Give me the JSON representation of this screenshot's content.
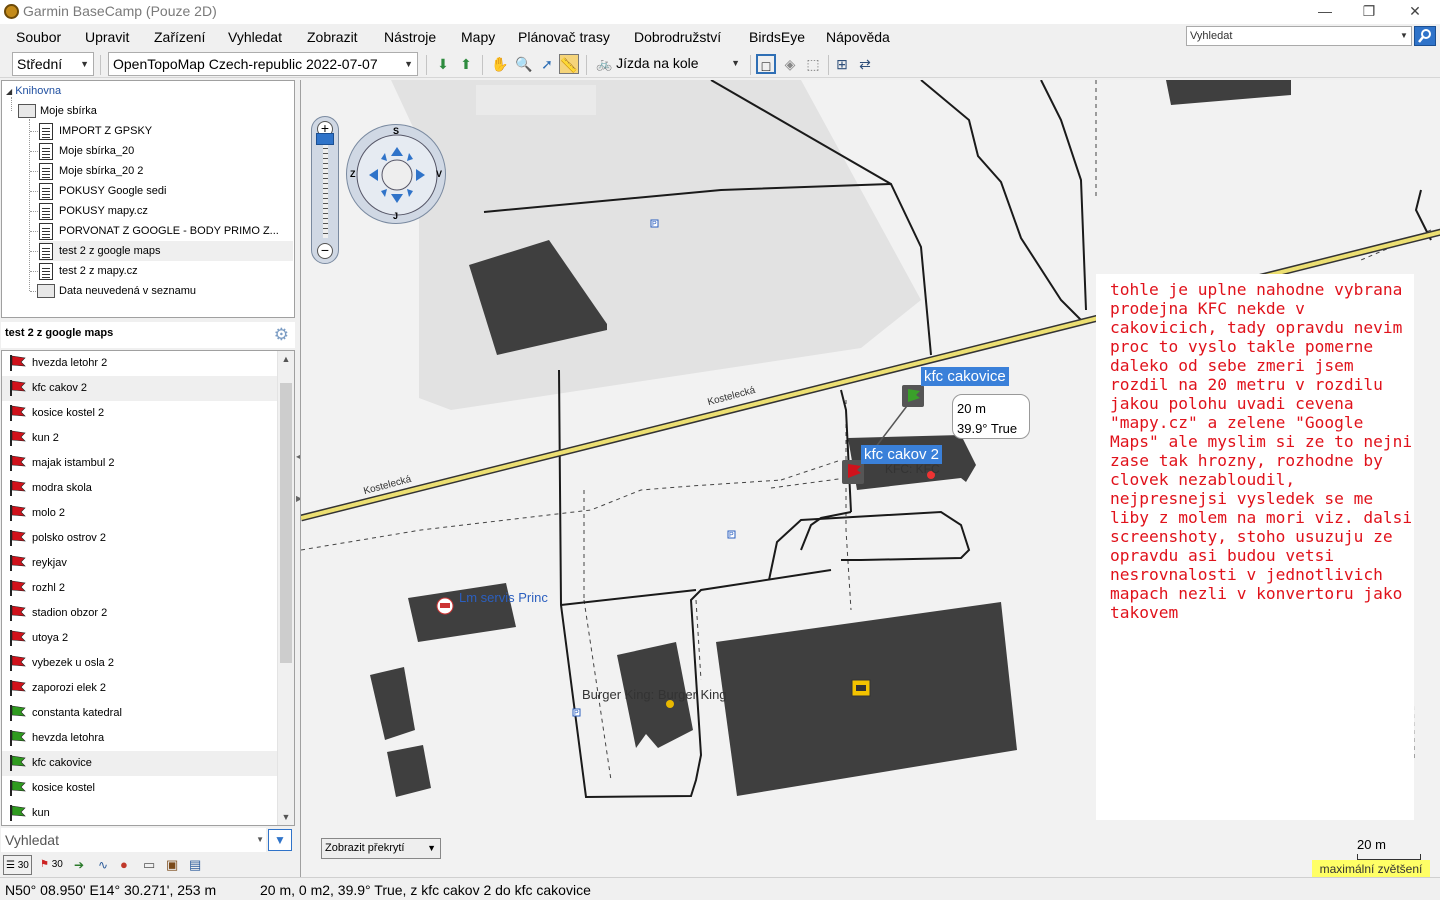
{
  "window": {
    "title": "Garmin BaseCamp (Pouze 2D)",
    "minimize": "—",
    "restore": "❐",
    "close": "✕"
  },
  "menu": [
    "Soubor",
    "Upravit",
    "Zařízení",
    "Vyhledat",
    "Zobrazit",
    "Nástroje",
    "Mapy",
    "Plánovač trasy",
    "Dobrodružství",
    "BirdsEye",
    "Nápověda"
  ],
  "top_search": {
    "placeholder": "Vyhledat"
  },
  "toolbar": {
    "detail_level": "Střední",
    "map_product": "OpenTopoMap Czech-republic 2022-07-07",
    "activity": "Jízda na kole"
  },
  "library": {
    "root": "Knihovna",
    "collection": "Moje sbírka",
    "items": [
      "IMPORT Z GPSKY",
      "Moje sbírka_20",
      "Moje sbírka_20 2",
      "POKUSY Google sedi",
      "POKUSY mapy.cz",
      "PORVONAT Z GOOGLE - BODY PRIMO Z...",
      "test 2 z google maps",
      "test 2 z mapy.cz"
    ],
    "unlisted": "Data neuvedená v seznamu",
    "selected_index": 6
  },
  "list": {
    "header": "test 2 z google maps",
    "items": [
      {
        "name": "hvezda letohr 2",
        "flag": "red"
      },
      {
        "name": "kfc cakov 2",
        "flag": "red",
        "selected": true
      },
      {
        "name": "kosice kostel 2",
        "flag": "red"
      },
      {
        "name": "kun 2",
        "flag": "red"
      },
      {
        "name": "majak istambul 2",
        "flag": "red"
      },
      {
        "name": "modra skola",
        "flag": "red"
      },
      {
        "name": "molo 2",
        "flag": "red"
      },
      {
        "name": "polsko ostrov 2",
        "flag": "red"
      },
      {
        "name": "reykjav",
        "flag": "red"
      },
      {
        "name": "rozhl 2",
        "flag": "red"
      },
      {
        "name": "stadion obzor 2",
        "flag": "red"
      },
      {
        "name": "utoya 2",
        "flag": "red"
      },
      {
        "name": "vybezek u osla 2",
        "flag": "red"
      },
      {
        "name": "zaporozi elek 2",
        "flag": "red"
      },
      {
        "name": "constanta katedral",
        "flag": "green"
      },
      {
        "name": "hevzda letohra",
        "flag": "green"
      },
      {
        "name": "kfc cakovice",
        "flag": "green",
        "selected": true
      },
      {
        "name": "kosice kostel",
        "flag": "green"
      },
      {
        "name": "kun",
        "flag": "green"
      }
    ],
    "search_placeholder": "Vyhledat",
    "bottom_counts": [
      "30",
      "30"
    ]
  },
  "map": {
    "roads": [
      "Kostelecká",
      "Kostelecká"
    ],
    "parking_label": "P",
    "places": [
      {
        "name": "kfc cakovice",
        "type": "chip"
      },
      {
        "name": "kfc cakov 2",
        "type": "chip"
      },
      {
        "name": "KFC: KFC",
        "type": "text"
      },
      {
        "name": "Lm servis Princ",
        "type": "text"
      },
      {
        "name": "Burger King: Burger King",
        "type": "text"
      }
    ],
    "measure": {
      "distance": "20 m",
      "bearing": "39.9° True"
    },
    "annotation": "tohle je uplne nahodne vybrana prodejna KFC nekde v cakovicich, tady opravdu nevim proc to vyslo takle pomerne daleko od sebe zmeri jsem rozdil na 20 metru v rozdilu jakou polohu uvadi cevena \"mapy.cz\" a zelene \"Google Maps\" ale myslim si ze to nejni zase tak hrozny, rozhodne by clovek nezabloudil, nejpresnejsi vysledek se me liby z molem na mori viz. dalsi screenshoty, stoho usuzuju ze opravdu asi budou vetsi nesrovnalosti v jednotlivich mapach nezli v konvertoru jako takovem",
    "overlay_select": "Zobrazit překrytí",
    "scale": "20 m",
    "max_zoom": "maximální zvětšení",
    "compass": {
      "n": "S",
      "s": "J",
      "e": "V",
      "w": "Z"
    }
  },
  "status": {
    "coords": "N50° 08.950' E14° 30.271', 253 m",
    "measure": "20 m, 0 m2, 39.9° True, z kfc cakov 2 do kfc cakovice"
  },
  "colors": {
    "accent": "#3a80d9",
    "annotation": "#e0121b",
    "flag_red": "#d0121b",
    "flag_green": "#2f9a1f",
    "road": "#e8d96b",
    "building": "#3f3f3f"
  }
}
